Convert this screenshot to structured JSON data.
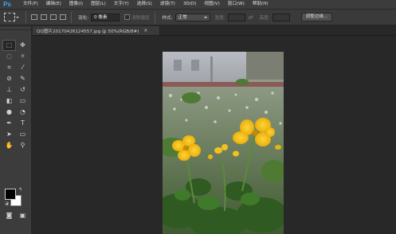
{
  "app": {
    "logo": "Ps",
    "menu": [
      "文件(F)",
      "编辑(E)",
      "图像(I)",
      "图层(L)",
      "文字(Y)",
      "选择(S)",
      "滤镜(T)",
      "3D(D)",
      "视图(V)",
      "窗口(W)",
      "帮助(H)"
    ]
  },
  "options": {
    "feather_label": "羽化:",
    "feather_value": "0 像素",
    "antialias_label": "消除锯齿",
    "style_label": "样式:",
    "style_value": "正常",
    "width_label": "宽度:",
    "height_label": "高度:",
    "refine_button": "调整边缘..."
  },
  "document": {
    "tab_title": "QQ图片20170426124557.jpg @ 50%(RGB/8#)",
    "tab_close": "×"
  },
  "tools": [
    {
      "name": "marquee-tool-icon",
      "glyph": "⬚"
    },
    {
      "name": "move-tool-icon",
      "glyph": "✥"
    },
    {
      "name": "lasso-tool-icon",
      "glyph": "◌"
    },
    {
      "name": "magic-wand-tool-icon",
      "glyph": "✧"
    },
    {
      "name": "crop-tool-icon",
      "glyph": "⌗"
    },
    {
      "name": "eyedropper-tool-icon",
      "glyph": "⁄"
    },
    {
      "name": "healing-brush-tool-icon",
      "glyph": "⊘"
    },
    {
      "name": "brush-tool-icon",
      "glyph": "✎"
    },
    {
      "name": "clone-stamp-tool-icon",
      "glyph": "⊥"
    },
    {
      "name": "history-brush-tool-icon",
      "glyph": "↺"
    },
    {
      "name": "eraser-tool-icon",
      "glyph": "◧"
    },
    {
      "name": "gradient-tool-icon",
      "glyph": "▭"
    },
    {
      "name": "blur-tool-icon",
      "glyph": "●"
    },
    {
      "name": "dodge-tool-icon",
      "glyph": "◔"
    },
    {
      "name": "pen-tool-icon",
      "glyph": "✒"
    },
    {
      "name": "type-tool-icon",
      "glyph": "T"
    },
    {
      "name": "path-selection-tool-icon",
      "glyph": "➤"
    },
    {
      "name": "rectangle-tool-icon",
      "glyph": "▭"
    },
    {
      "name": "hand-tool-icon",
      "glyph": "✋"
    },
    {
      "name": "zoom-tool-icon",
      "glyph": "⚲"
    }
  ],
  "colors": {
    "foreground": "#000000",
    "background": "#ffffff",
    "accent": "#31a8ff"
  },
  "bottom_tools": [
    {
      "name": "quick-mask-icon",
      "glyph": "◙"
    },
    {
      "name": "screen-mode-icon",
      "glyph": "▣"
    }
  ]
}
